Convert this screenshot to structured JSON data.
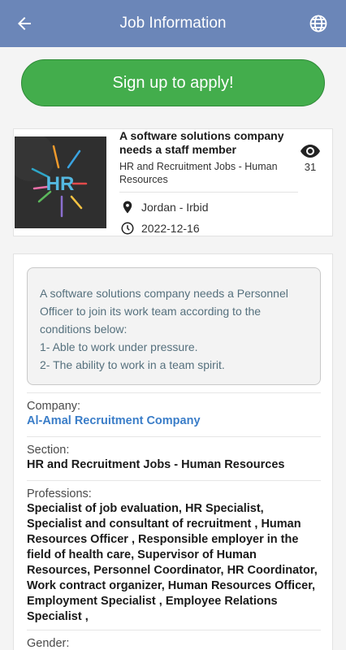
{
  "header": {
    "title": "Job Information"
  },
  "apply_button": "Sign up to apply!",
  "job": {
    "headline": "A software solutions company needs a staff member",
    "category": "HR and Recruitment Jobs - Human Resources",
    "location": "Jordan - Irbid",
    "date": "2022-12-16",
    "views": "31",
    "thumb_text": "HR"
  },
  "description": [
    "A software solutions company needs a Personnel Officer to join its work team according to the conditions below:",
    "1- Able to work under pressure.",
    "2- The ability to work in a team spirit."
  ],
  "fields": {
    "company_label": "Company:",
    "company_value": "Al-Amal Recruitment Company",
    "section_label": "Section:",
    "section_value": "HR and Recruitment Jobs - Human Resources",
    "professions_label": "Professions:",
    "professions_value": "Specialist of job evaluation, HR Specialist, Specialist and consultant of recruitment , Human Resources Officer , Responsible employer in the field of health care, Supervisor of Human Resources, Personnel Coordinator,  HR Coordinator, Work contract organizer, Human Resources Officer, Employment Specialist , Employee Relations Specialist ,",
    "gender_label": "Gender:"
  },
  "colors": {
    "appbar": "#6b86b8",
    "apply": "#43ad4c",
    "link": "#3a7dc8"
  }
}
